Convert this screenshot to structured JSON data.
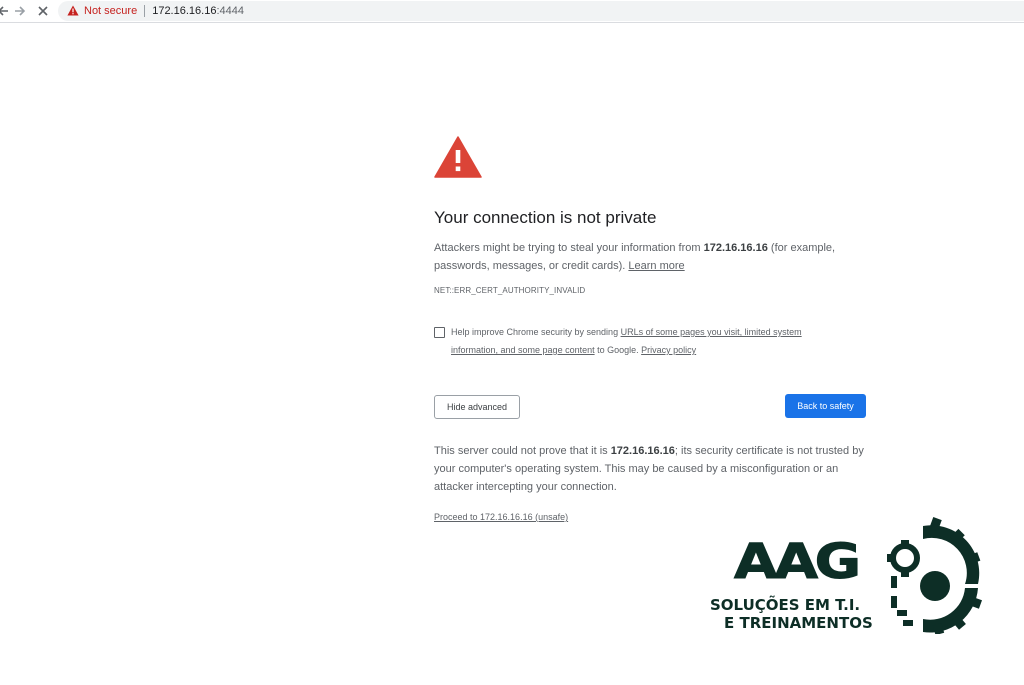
{
  "browser": {
    "back_icon": "arrow-left-icon",
    "forward_icon": "arrow-right-icon",
    "stop_icon": "close-icon",
    "security_label": "Not secure",
    "url_host": "172.16.16.16",
    "url_port": ":4444"
  },
  "interstitial": {
    "heading": "Your connection is not private",
    "intro_before": "Attackers might be trying to steal your information from ",
    "intro_host": "172.16.16.16",
    "intro_after": " (for example, passwords, messages, or credit cards). ",
    "learn_more": "Learn more",
    "error_code": "NET::ERR_CERT_AUTHORITY_INVALID",
    "optin_before": "Help improve Chrome security by sending ",
    "optin_link": "URLs of some pages you visit, limited system information, and some page content",
    "optin_middle": " to Google. ",
    "privacy_link": "Privacy policy",
    "hide_advanced": "Hide advanced",
    "back_to_safety": "Back to safety",
    "details_before": "This server could not prove that it is ",
    "details_host": "172.16.16.16",
    "details_after": "; its security certificate is not trusted by your computer's operating system. This may be caused by a misconfiguration or an attacker intercepting your connection.",
    "proceed_link": "Proceed to 172.16.16.16 (unsafe)"
  },
  "watermark": {
    "brand": "AAG",
    "line1": "SOLUÇÕES EM T.I.",
    "line2": "E TREINAMENTOS"
  },
  "colors": {
    "warning_red": "#db4437",
    "not_secure_red": "#c5221f",
    "primary_blue": "#1a73e8",
    "logo_green": "#0d2e26"
  }
}
